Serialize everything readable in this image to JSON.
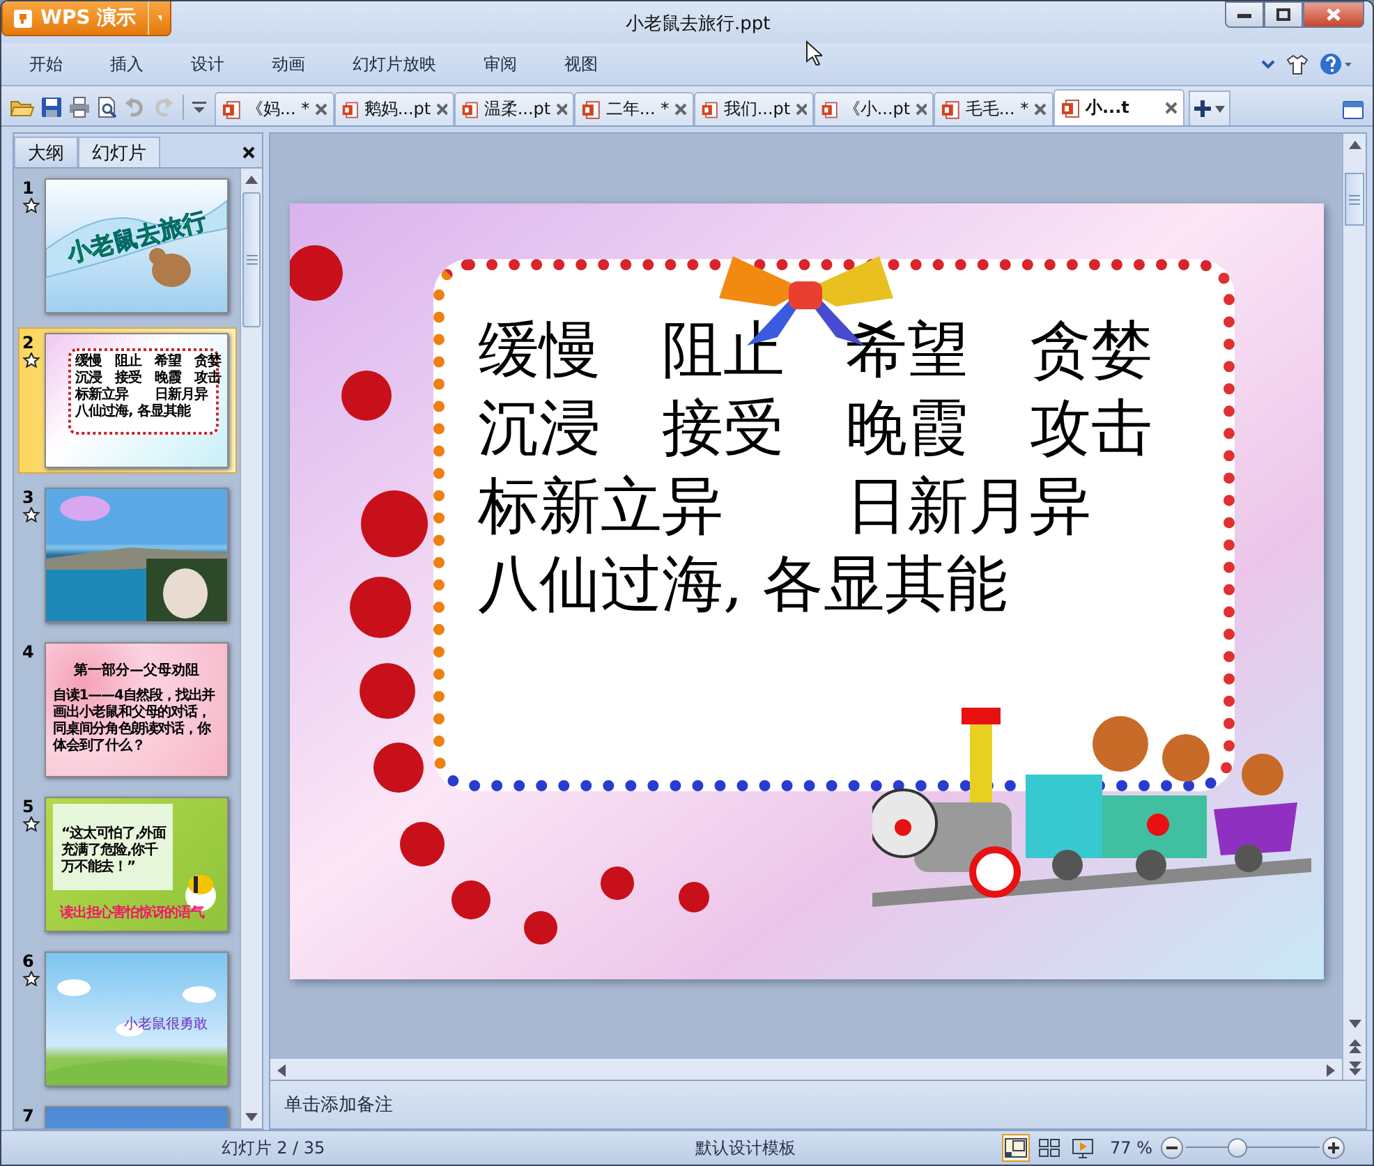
{
  "window": {
    "title": "小老鼠去旅行.ppt",
    "app_button": "WPS 演示"
  },
  "menu": [
    "开始",
    "插入",
    "设计",
    "动画",
    "幻灯片放映",
    "审阅",
    "视图"
  ],
  "doc_tabs": [
    {
      "label": "《妈... *",
      "selected": false
    },
    {
      "label": "鹅妈...pt",
      "selected": false
    },
    {
      "label": "温柔...pt",
      "selected": false
    },
    {
      "label": "二年... *",
      "selected": false
    },
    {
      "label": "我们...pt",
      "selected": false
    },
    {
      "label": "《小...pt",
      "selected": false
    },
    {
      "label": "毛毛... *",
      "selected": false
    },
    {
      "label": "小...t",
      "selected": true
    }
  ],
  "sidebar": {
    "tabs": [
      {
        "label": "大纲",
        "selected": false
      },
      {
        "label": "幻灯片",
        "selected": true
      }
    ],
    "slides": [
      {
        "number": "1",
        "selected": false,
        "has_animation": true,
        "kind": "title",
        "texts": [
          "小老鼠去旅行"
        ]
      },
      {
        "number": "2",
        "selected": true,
        "has_animation": true,
        "kind": "words",
        "texts": [
          "缓慢　阻止　希望　贪婪",
          "沉浸　接受　晚霞　攻击",
          "标新立异　　日新月异",
          "八仙过海, 各显其能"
        ]
      },
      {
        "number": "3",
        "selected": false,
        "has_animation": true
      },
      {
        "number": "4",
        "selected": false,
        "has_animation": false,
        "kind": "hearts",
        "texts": [
          "第一部分—父母劝阻",
          "自读1——4自然段，找出并画出小老鼠和父母的对话，同桌间分角色朗读对话，你体会到了什么？"
        ]
      },
      {
        "number": "5",
        "selected": false,
        "has_animation": true,
        "kind": "meadow",
        "texts": [
          "“这太可怕了,外面充满了危险,你千万不能去！”",
          "读出担心害怕惊讶的语气"
        ]
      },
      {
        "number": "6",
        "selected": false,
        "has_animation": true,
        "kind": "sky",
        "texts": [
          "小老鼠很勇敢"
        ]
      },
      {
        "number": "7",
        "selected": false,
        "has_animation": false,
        "kind": "cut"
      }
    ]
  },
  "slide": {
    "lines": [
      "缓慢　阻止　希望　贪婪",
      "沉浸　接受　晚霞　攻击",
      "标新立异　　日新月异",
      "八仙过海, 各显其能"
    ]
  },
  "notes": {
    "placeholder": "单击添加备注"
  },
  "status_bar": {
    "slide_counter": "幻灯片 2 / 35",
    "template": "默认设计模板",
    "zoom": "77 %",
    "views": [
      {
        "kind": "normal",
        "selected": true
      },
      {
        "kind": "sorter",
        "selected": false
      },
      {
        "kind": "show",
        "selected": false
      }
    ],
    "zoom_slider": {
      "level": 0.38
    }
  }
}
